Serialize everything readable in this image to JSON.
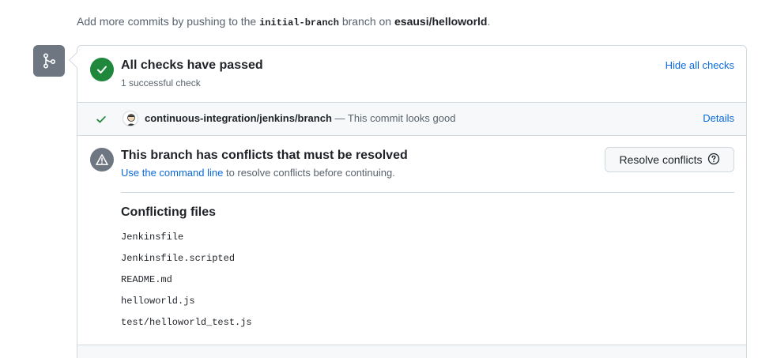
{
  "hint": {
    "prefix": "Add more commits by pushing to the ",
    "branch": "initial-branch",
    "middle": " branch on ",
    "repo": "esausi/helloworld",
    "suffix": "."
  },
  "checks": {
    "title": "All checks have passed",
    "subtitle": "1 successful check",
    "hide_label": "Hide all checks",
    "items": [
      {
        "name": "continuous-integration/jenkins/branch",
        "description": " — This commit looks good",
        "details_label": "Details"
      }
    ]
  },
  "conflicts": {
    "title": "This branch has conflicts that must be resolved",
    "link_text": "Use the command line",
    "subtitle_rest": " to resolve conflicts before continuing.",
    "button_label": "Resolve conflicts",
    "files_heading": "Conflicting files",
    "files": [
      "Jenkinsfile",
      "Jenkinsfile.scripted",
      "README.md",
      "helloworld.js",
      "test/helloworld_test.js"
    ]
  },
  "colors": {
    "success": "#1f883d",
    "neutral_icon": "#6e7781",
    "link": "#0969da",
    "border": "#d1d9e0",
    "muted_text": "#59636e"
  },
  "icons": {
    "merge": "git-merge-icon",
    "check": "check-icon",
    "alert": "alert-icon",
    "question": "question-icon"
  }
}
